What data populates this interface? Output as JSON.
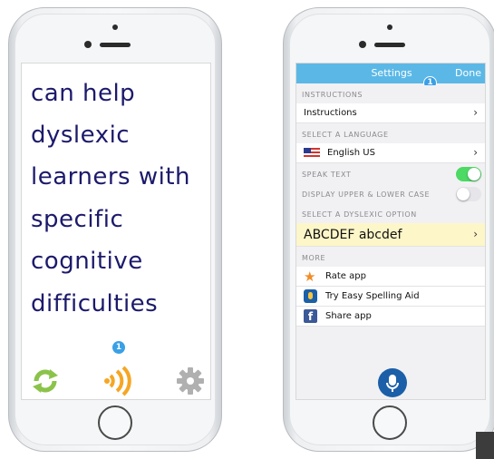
{
  "left_phone": {
    "lines": [
      "can help",
      "dyslexic",
      "learners with",
      "specific",
      "cognitive",
      "difficulties"
    ],
    "badge": "1",
    "icons": [
      "refresh-icon",
      "speaker-icon",
      "gear-icon"
    ],
    "colors": {
      "text": "#1c1a6b",
      "refresh": "#8bc34a",
      "speaker": "#f5a623",
      "gear": "#aaaaaa",
      "badge": "#3aa0e6"
    }
  },
  "right_phone": {
    "navbar": {
      "title": "Settings",
      "done": "Done",
      "badge": "1",
      "color": "#5bb8e6"
    },
    "sections": {
      "instructions": "INSTRUCTIONS",
      "language": "SELECT A LANGUAGE",
      "dyslexic": "SELECT A DYSLEXIC OPTION",
      "more": "MORE"
    },
    "rows": {
      "instructions": "Instructions",
      "language": "English US",
      "speak_text": "SPEAK TEXT",
      "case": "DISPLAY UPPER & LOWER CASE",
      "font_sample": "ABCDEF abcdef",
      "rate": "Rate app",
      "try": "Try Easy Spelling Aid",
      "share": "Share app"
    },
    "toggles": {
      "speak_text": true,
      "upper_lower_case": false
    },
    "chevron": "›",
    "colors": {
      "toggle_on": "#4cd964",
      "font_row_bg": "#fdf6c8",
      "mic": "#1b5fa8"
    }
  }
}
